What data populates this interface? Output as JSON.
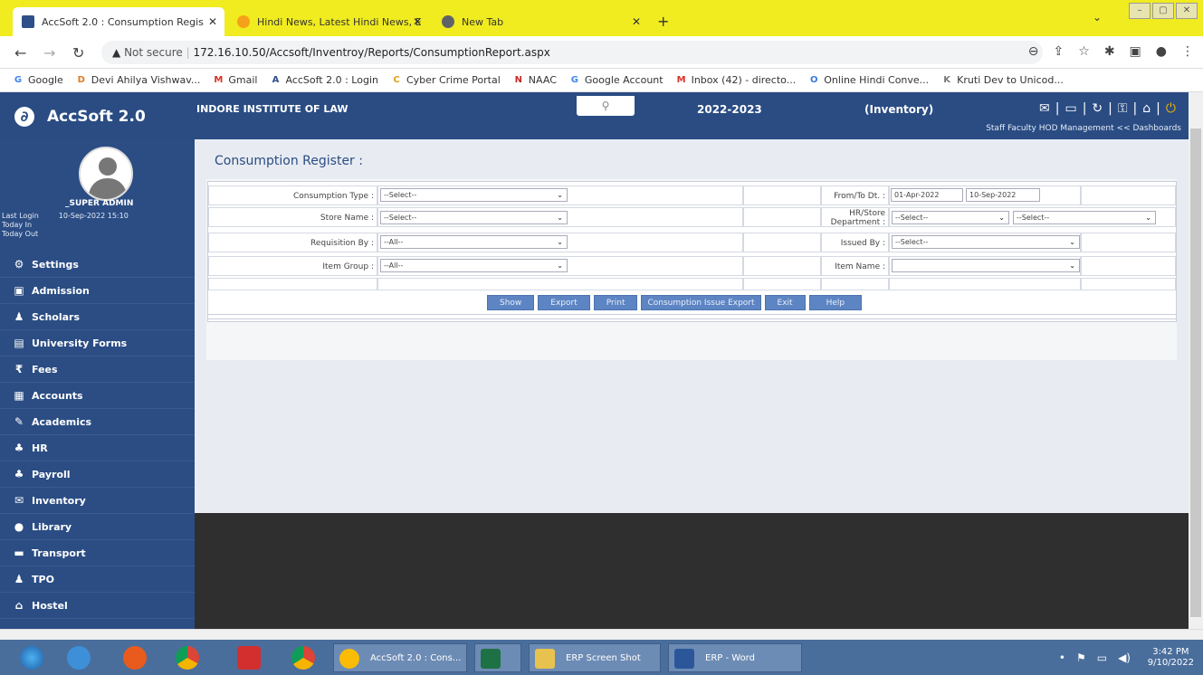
{
  "browser": {
    "tabs": [
      {
        "title": "AccSoft 2.0 : Consumption Regis",
        "active": true,
        "color": "#2f4f8a"
      },
      {
        "title": "Hindi News, Latest Hindi News, E",
        "active": false,
        "color": "#f5a21a"
      },
      {
        "title": "New Tab",
        "active": false,
        "color": "#5f6368"
      }
    ],
    "address": {
      "security": "Not secure",
      "url": "172.16.10.50/Accsoft/Inventroy/Reports/ConsumptionReport.aspx"
    },
    "bookmarks": [
      {
        "label": "Google",
        "icon": "G",
        "color": "#4285f4"
      },
      {
        "label": "Devi Ahilya Vishwav...",
        "icon": "D",
        "color": "#e07b20"
      },
      {
        "label": "Gmail",
        "icon": "M",
        "color": "#d93025"
      },
      {
        "label": "AccSoft 2.0 : Login",
        "icon": "A",
        "color": "#2f4f8a"
      },
      {
        "label": "Cyber Crime Portal",
        "icon": "C",
        "color": "#e0a020"
      },
      {
        "label": "NAAC",
        "icon": "N",
        "color": "#c62828"
      },
      {
        "label": "Google Account",
        "icon": "G",
        "color": "#4285f4"
      },
      {
        "label": "Inbox (42) - directo...",
        "icon": "M",
        "color": "#d93025"
      },
      {
        "label": "Online Hindi Conve...",
        "icon": "O",
        "color": "#3a7bd5"
      },
      {
        "label": "Kruti Dev to Unicod...",
        "icon": "K",
        "color": "#777"
      }
    ]
  },
  "header": {
    "app_name": "AccSoft 2.0",
    "institute": "INDORE INSTITUTE OF LAW",
    "session": "2022-2023",
    "module": "(Inventory)",
    "dash_links": "Staff  Faculty  HOD  Management << Dashboards"
  },
  "user": {
    "name": "_SUPER ADMIN",
    "last_login_label": "Last Login",
    "last_login_value": "10-Sep-2022 15:10",
    "today_in": "Today In",
    "today_out": "Today Out"
  },
  "menu": [
    {
      "label": "Settings",
      "icon": "⚙"
    },
    {
      "label": "Admission",
      "icon": "▣"
    },
    {
      "label": "Scholars",
      "icon": "♟"
    },
    {
      "label": "University Forms",
      "icon": "▤"
    },
    {
      "label": "Fees",
      "icon": "₹"
    },
    {
      "label": "Accounts",
      "icon": "▦"
    },
    {
      "label": "Academics",
      "icon": "✎"
    },
    {
      "label": "HR",
      "icon": "♣"
    },
    {
      "label": "Payroll",
      "icon": "♣"
    },
    {
      "label": "Inventory",
      "icon": "✉"
    },
    {
      "label": "Library",
      "icon": "●"
    },
    {
      "label": "Transport",
      "icon": "▬"
    },
    {
      "label": "TPO",
      "icon": "♟"
    },
    {
      "label": "Hostel",
      "icon": "⌂"
    }
  ],
  "page": {
    "title": "Consumption Register :",
    "fields": {
      "consumption_type": {
        "label": "Consumption Type :",
        "value": "--Select--"
      },
      "store_name": {
        "label": "Store Name :",
        "value": "--Select--"
      },
      "requisition_by": {
        "label": "Requisition By :",
        "value": "--All--"
      },
      "item_group": {
        "label": "Item Group :",
        "value": "--All--"
      },
      "from_to": {
        "label": "From/To Dt. :",
        "from": "01-Apr-2022",
        "to": "10-Sep-2022"
      },
      "hr_store": {
        "label1": "HR/Store",
        "label2": "Department :",
        "value1": "--Select--",
        "value2": "--Select--"
      },
      "issued_by": {
        "label": "Issued By :",
        "value": "--Select--"
      },
      "item_name": {
        "label": "Item Name :",
        "value": ""
      }
    },
    "buttons": [
      "Show",
      "Export",
      "Print",
      "Consumption Issue Export",
      "Exit",
      "Help"
    ]
  },
  "taskbar": {
    "windows": [
      {
        "label": "AccSoft 2.0 : Cons...",
        "color": "#fbbc05"
      },
      {
        "label": "",
        "color": "#1e7145"
      },
      {
        "label": "ERP Screen Shot",
        "color": "#e7c24f"
      },
      {
        "label": "ERP - Word",
        "color": "#2b579a"
      }
    ],
    "time": "3:42 PM",
    "date": "9/10/2022"
  }
}
